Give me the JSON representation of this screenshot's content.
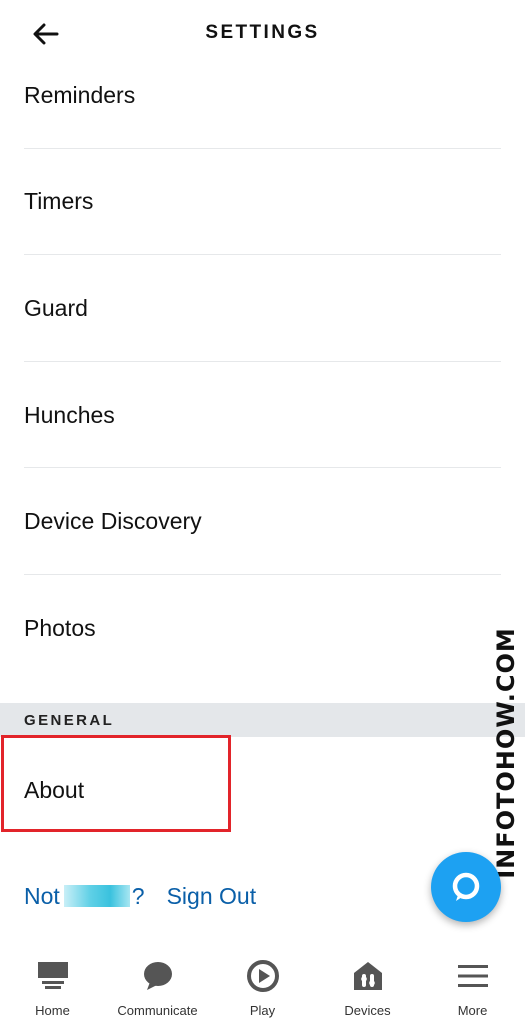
{
  "header": {
    "title": "SETTINGS"
  },
  "settings_items": [
    {
      "label": "Reminders"
    },
    {
      "label": "Timers"
    },
    {
      "label": "Guard"
    },
    {
      "label": "Hunches"
    },
    {
      "label": "Device Discovery"
    },
    {
      "label": "Photos"
    }
  ],
  "general": {
    "section_title": "GENERAL",
    "about_label": "About"
  },
  "account": {
    "not_label": "Not",
    "question_mark": "?",
    "sign_out_label": "Sign Out"
  },
  "watermark": "INFOTOHOW.COM",
  "tabs": [
    {
      "label": "Home",
      "icon": "home-icon"
    },
    {
      "label": "Communicate",
      "icon": "chat-bubble-icon"
    },
    {
      "label": "Play",
      "icon": "play-icon"
    },
    {
      "label": "Devices",
      "icon": "devices-icon"
    },
    {
      "label": "More",
      "icon": "menu-icon"
    }
  ],
  "colors": {
    "link": "#0a5fa8",
    "alexa": "#1da1f2",
    "highlight": "#e2242a",
    "section_bg": "#e4e7ea"
  }
}
